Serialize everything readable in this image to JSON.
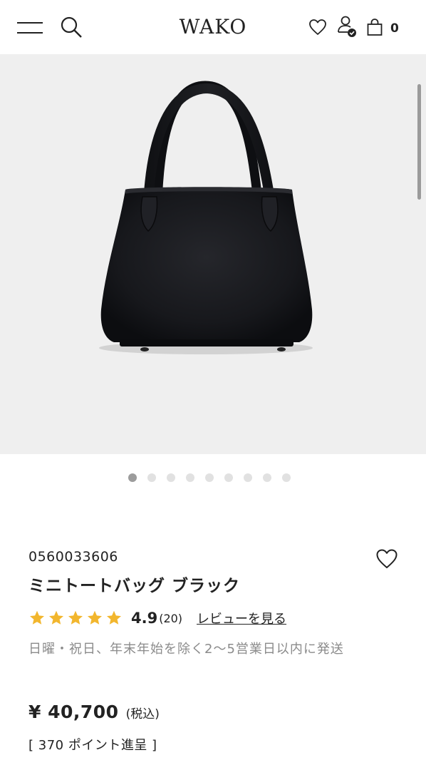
{
  "header": {
    "logo": "WAKO",
    "cart_count": "0",
    "icons": {
      "menu": "hamburger-menu-icon",
      "search": "search-icon",
      "favorite": "heart-icon",
      "account": "user-check-icon",
      "cart": "shopping-bag-icon"
    }
  },
  "gallery": {
    "image": "black-leather-mini-tote-photo",
    "background": "#efefef",
    "dots": [
      {
        "active": true
      },
      {
        "active": false
      },
      {
        "active": false
      },
      {
        "active": false
      },
      {
        "active": false
      },
      {
        "active": false
      },
      {
        "active": false
      },
      {
        "active": false
      },
      {
        "active": false
      }
    ]
  },
  "product": {
    "sku": "0560033606",
    "title": "ミニトートバッグ ブラック",
    "rating": {
      "stars": 5,
      "value": "4.9",
      "count": "(20)",
      "review_link": "レビューを見る"
    },
    "shipping_note": "日曜・祝日、年末年始を除く2〜5営業日以内に発送",
    "price": "¥ 40,700",
    "tax_label": "(税込)",
    "points": "[ 370 ポイント進呈 ]"
  },
  "colors": {
    "star": "#f2b62d",
    "text": "#222222",
    "muted": "#8b8b8b",
    "dot_active": "#9c9c9c",
    "dot_inactive": "#e1e1e1"
  }
}
